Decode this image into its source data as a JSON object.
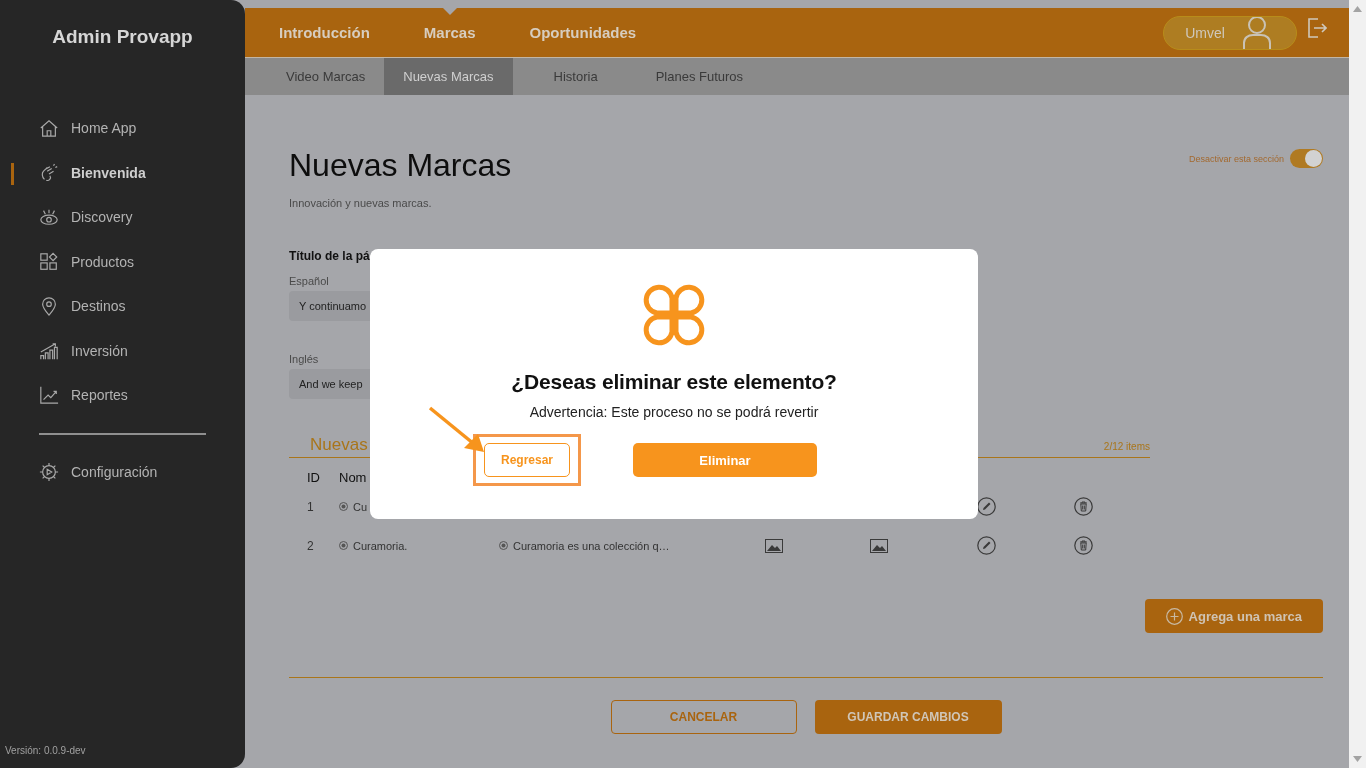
{
  "sidebar": {
    "title": "Admin Provapp",
    "items": [
      {
        "label": "Home App",
        "selected": false
      },
      {
        "label": "Bienvenida",
        "selected": true
      },
      {
        "label": "Discovery",
        "selected": false
      },
      {
        "label": "Productos",
        "selected": false
      },
      {
        "label": "Destinos",
        "selected": false
      },
      {
        "label": "Inversión",
        "selected": false
      },
      {
        "label": "Reportes",
        "selected": false
      }
    ],
    "settings": {
      "label": "Configuración",
      "selected": false
    },
    "version": "Versión: 0.0.9-dev"
  },
  "topnav": {
    "tabs": [
      {
        "label": "Introducción",
        "selected": false
      },
      {
        "label": "Marcas",
        "selected": true
      },
      {
        "label": "Oportunidades",
        "selected": false
      }
    ],
    "user": "Umvel"
  },
  "subnav": [
    {
      "label": "Video Marcas",
      "selected": false
    },
    {
      "label": "Nuevas Marcas",
      "selected": true
    },
    {
      "label": "Historia",
      "selected": false
    },
    {
      "label": "Planes Futuros",
      "selected": false
    }
  ],
  "page": {
    "title": "Nuevas Marcas",
    "subtitle": "Innovación y nuevas marcas.",
    "toggle": {
      "label": "Desactivar esta sección",
      "on": true
    },
    "section_label": "Título de la pá",
    "fields": [
      {
        "label": "Español",
        "value": "Y continuamo"
      },
      {
        "label": "Inglés",
        "value": "And we keep"
      }
    ],
    "list": {
      "title": "Nuevas",
      "count": "2/12 items",
      "columns": [
        "ID",
        "Nom"
      ],
      "rows": [
        {
          "cells": [
            {
              "kind": "id",
              "text": "1"
            },
            {
              "kind": "radio-text",
              "text": "Cu"
            },
            {
              "kind": "edit"
            },
            {
              "kind": "delete"
            }
          ]
        },
        {
          "cells": [
            {
              "kind": "id",
              "text": "2"
            },
            {
              "kind": "radio-text",
              "text": "Curamoria."
            },
            {
              "kind": "radio-text",
              "text": "Curamoria es una colección q…"
            },
            {
              "kind": "image"
            },
            {
              "kind": "image"
            },
            {
              "kind": "edit"
            },
            {
              "kind": "delete"
            }
          ]
        }
      ]
    },
    "add_button": "Agrega una marca",
    "cancel_button": "CANCELAR",
    "save_button": "GUARDAR CAMBIOS"
  },
  "dialog": {
    "title": "¿Deseas eliminar este elemento?",
    "message": "Advertencia: Este proceso no se podrá revertir",
    "back_button": "Regresar",
    "back_highlighted": true,
    "delete_button": "Eliminar"
  }
}
